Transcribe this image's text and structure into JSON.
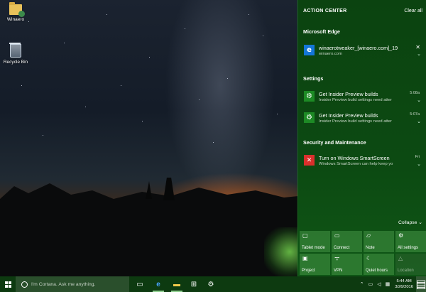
{
  "desktop": {
    "icons": [
      {
        "label": "Winaero",
        "icon": "folder-icon"
      },
      {
        "label": "Recycle Bin",
        "icon": "recycle-bin-icon"
      }
    ]
  },
  "action_center": {
    "title": "ACTION CENTER",
    "clear_all": "Clear all",
    "groups": [
      {
        "name": "Microsoft Edge",
        "notifications": [
          {
            "icon": "edge-icon",
            "title": "winaerotweaker_[winaero.com]_19",
            "subtitle": "winaero.com",
            "time": ""
          }
        ]
      },
      {
        "name": "Settings",
        "notifications": [
          {
            "icon": "settings-gear-icon",
            "title": "Get Insider Preview builds",
            "subtitle": "Insider Preview build settings need atter",
            "time": "5:08a"
          },
          {
            "icon": "settings-gear-icon",
            "title": "Get Insider Preview builds",
            "subtitle": "Insider Preview build settings need atter",
            "time": "5:07a"
          }
        ]
      },
      {
        "name": "Security and Maintenance",
        "notifications": [
          {
            "icon": "error-icon",
            "title": "Turn on Windows SmartScreen",
            "subtitle": "Windows SmartScreen can help keep yo",
            "time": "Fri"
          }
        ]
      }
    ],
    "collapse": "Collapse",
    "quick_actions": [
      {
        "label": "Tablet mode",
        "icon": "tablet-mode-icon",
        "glyph": "▢",
        "enabled": true
      },
      {
        "label": "Connect",
        "icon": "connect-icon",
        "glyph": "▭",
        "enabled": true
      },
      {
        "label": "Note",
        "icon": "note-icon",
        "glyph": "▱",
        "enabled": true
      },
      {
        "label": "All settings",
        "icon": "gear-icon",
        "glyph": "⚙",
        "enabled": true
      },
      {
        "label": "Project",
        "icon": "project-icon",
        "glyph": "▣",
        "enabled": true
      },
      {
        "label": "VPN",
        "icon": "vpn-icon",
        "glyph": "ᯤ",
        "enabled": true
      },
      {
        "label": "Quiet hours",
        "icon": "moon-icon",
        "glyph": "☾",
        "enabled": true
      },
      {
        "label": "Location",
        "icon": "location-icon",
        "glyph": "△",
        "enabled": false
      }
    ]
  },
  "taskbar": {
    "search_placeholder": "I'm Cortana. Ask me anything.",
    "clock_time": "5:44 AM",
    "clock_date": "3/26/2016"
  }
}
